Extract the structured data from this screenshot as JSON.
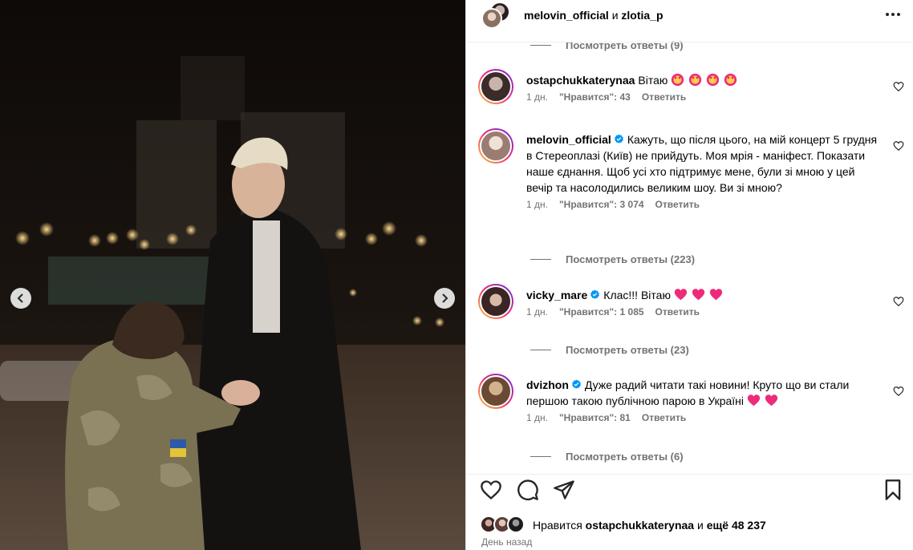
{
  "header": {
    "user1": "melovin_official",
    "joiner": "и",
    "user2": "zlotia_p"
  },
  "top_replies": "Посмотреть ответы (9)",
  "comments": [
    {
      "user": "ostapchukkaterynaa",
      "verified": false,
      "text": "Вітаю",
      "emoji_count": 4,
      "time": "1 дн.",
      "likes": "\"Нравится\": 43",
      "reply": "Ответить",
      "replies_label": ""
    },
    {
      "user": "melovin_official",
      "verified": true,
      "text": "Кажуть, що після цього, на мій концерт 5 грудня в Стереоплазі (Київ) не прийдуть. Моя мрія - маніфест. Показати наше єднання. Щоб усі хто підтримує мене, були зі мною у цей вечір та насолодились великим шоу. Ви зі мною?",
      "time": "1 дн.",
      "likes": "\"Нравится\": 3 074",
      "reply": "Ответить",
      "replies_label": "Посмотреть ответы (223)"
    },
    {
      "user": "vicky_mare",
      "verified": true,
      "text": "Клас!!! Вітаю",
      "emoji_count": 3,
      "time": "1 дн.",
      "likes": "\"Нравится\": 1 085",
      "reply": "Ответить",
      "replies_label": "Посмотреть ответы (23)"
    },
    {
      "user": "dvizhon",
      "verified": true,
      "text": "Дуже радий читати такі новини! Круто що ви стали першою такою публічною парою в Україні",
      "emoji_count": 2,
      "time": "1 дн.",
      "likes": "\"Нравится\": 81",
      "reply": "Ответить",
      "replies_label": "Посмотреть ответы (6)"
    }
  ],
  "footer": {
    "likes_prefix": "Нравится",
    "likes_user": "ostapchukkaterynaa",
    "likes_joiner": "и",
    "likes_more": "ещё 48 237",
    "date": "День назад"
  },
  "icons": {
    "like": "heart-icon",
    "comment": "comment-icon",
    "share": "paper-plane-icon",
    "save": "bookmark-icon",
    "more": "more-horizontal-icon",
    "verified": "verified-badge-icon"
  },
  "colors": {
    "verified": "#0095f6",
    "emoji_heart": "#ee2a7b",
    "meta_text": "#737373"
  }
}
